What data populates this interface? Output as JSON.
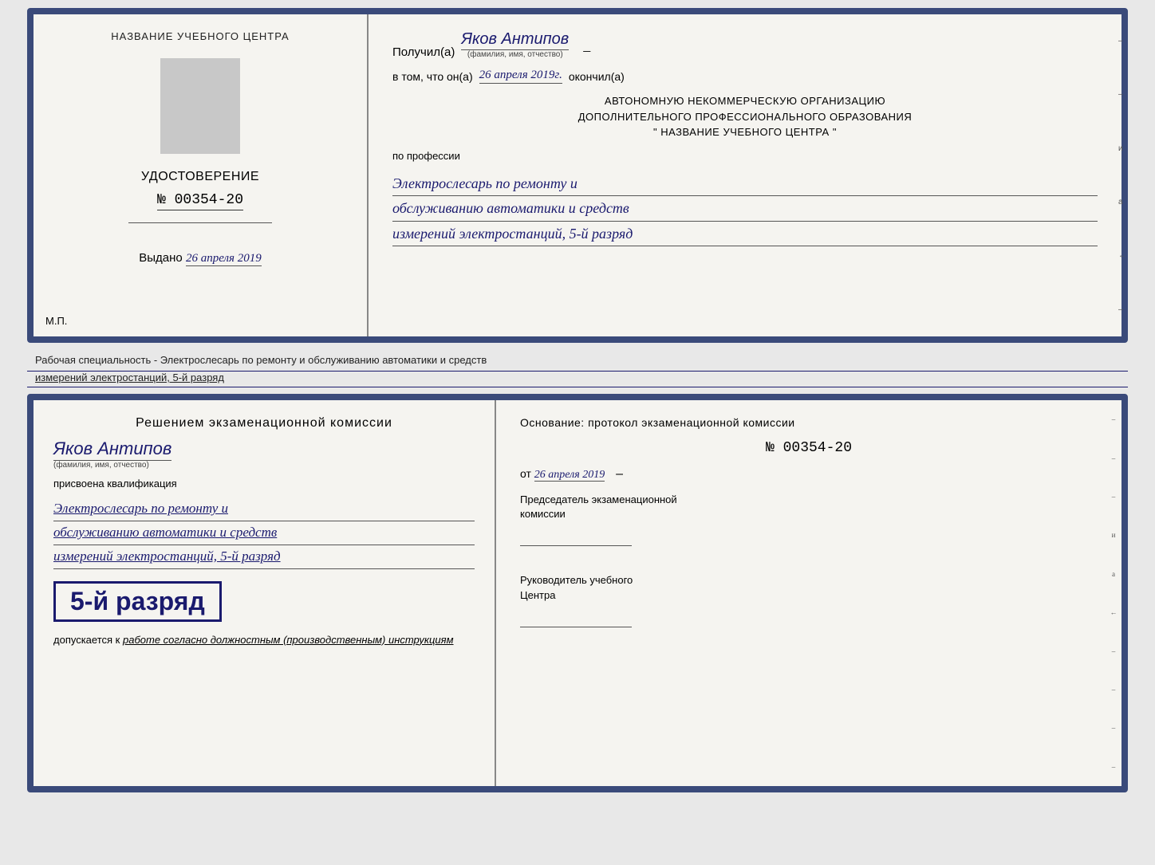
{
  "top_document": {
    "left": {
      "center_title": "НАЗВАНИЕ УЧЕБНОГО ЦЕНТРА",
      "udostoverenie": "УДОСТОВЕРЕНИЕ",
      "cert_number": "№ 00354-20",
      "vydano_label": "Выдано",
      "vydano_date": "26 апреля 2019",
      "mp_label": "М.П."
    },
    "right": {
      "recipient_prefix": "Получил(а)",
      "recipient_name": "Яков Антипов",
      "recipient_subtitle": "(фамилия, имя, отчество)",
      "date_prefix": "в том, что он(а)",
      "date_value": "26 апреля 2019г.",
      "date_suffix": "окончил(а)",
      "institution_line1": "АВТОНОМНУЮ НЕКОММЕРЧЕСКУЮ ОРГАНИЗАЦИЮ",
      "institution_line2": "ДОПОЛНИТЕЛЬНОГО ПРОФЕССИОНАЛЬНОГО ОБРАЗОВАНИЯ",
      "institution_line3": "\"   НАЗВАНИЕ УЧЕБНОГО ЦЕНТРА   \"",
      "po_professii": "по профессии",
      "profession_line1": "Электрослесарь по ремонту и",
      "profession_line2": "обслуживанию автоматики и средств",
      "profession_line3": "измерений электростанций, 5-й разряд"
    }
  },
  "middle_text": "Рабочая специальность - Электрослесарь по ремонту и обслуживанию автоматики и средств",
  "middle_text2": "измерений электростанций, 5-й разряд",
  "bottom_document": {
    "left": {
      "resheniem_title": "Решением экзаменационной комиссии",
      "person_name": "Яков Антипов",
      "person_subtitle": "(фамилия, имя, отчество)",
      "prisvoena": "присвоена квалификация",
      "profession_line1": "Электрослесарь по ремонту и",
      "profession_line2": "обслуживанию автоматики и средств",
      "profession_line3": "измерений электростанций, 5-й разряд",
      "grade_text": "5-й разряд",
      "dopuskaetsya": "допускается к",
      "dopuskaetsya_italic": "работе согласно должностным (производственным) инструкциям"
    },
    "right": {
      "osnovanie": "Основание: протокол экзаменационной комиссии",
      "protocol_number": "№  00354-20",
      "ot_prefix": "от",
      "ot_date": "26 апреля 2019",
      "predsedatel_line1": "Председатель экзаменационной",
      "predsedatel_line2": "комиссии",
      "rukovoditel_line1": "Руководитель учебного",
      "rukovoditel_line2": "Центра"
    }
  }
}
